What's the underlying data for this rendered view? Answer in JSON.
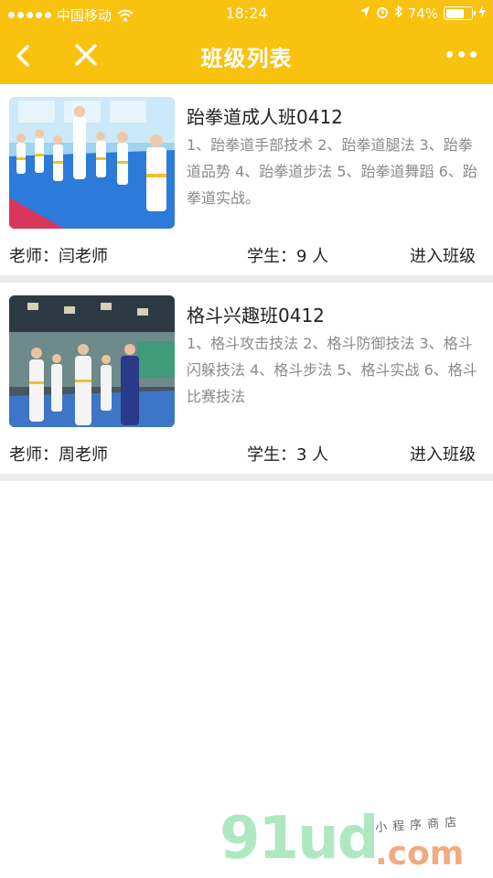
{
  "status_bar": {
    "carrier": "中国移动",
    "time": "18:24",
    "battery_percent": "74%",
    "battery_level": 0.74
  },
  "nav": {
    "title": "班级列表"
  },
  "classes": [
    {
      "name": "跆拳道成人班0412",
      "description": "1、跆拳道手部技术 2、跆拳道腿法 3、跆拳道品势 4、跆拳道步法 5、跆拳道舞蹈 6、跆拳道实战。",
      "teacher": "老师：闫老师",
      "students": "学生：9 人",
      "enter": "进入班级"
    },
    {
      "name": "格斗兴趣班0412",
      "description": "1、格斗攻击技法 2、格斗防御技法 3、格斗闪躲技法 4、格斗步法 5、格斗实战 6、格斗比赛技法",
      "teacher": "老师：周老师",
      "students": "学生：3 人",
      "enter": "进入班级"
    }
  ],
  "watermark": {
    "brand": "91ud",
    "domain": ".com",
    "tagline": "小程序商店"
  },
  "colors": {
    "brand_yellow": "#f9c20e",
    "divider": "#ececec",
    "desc_gray": "#8a8a8a"
  }
}
